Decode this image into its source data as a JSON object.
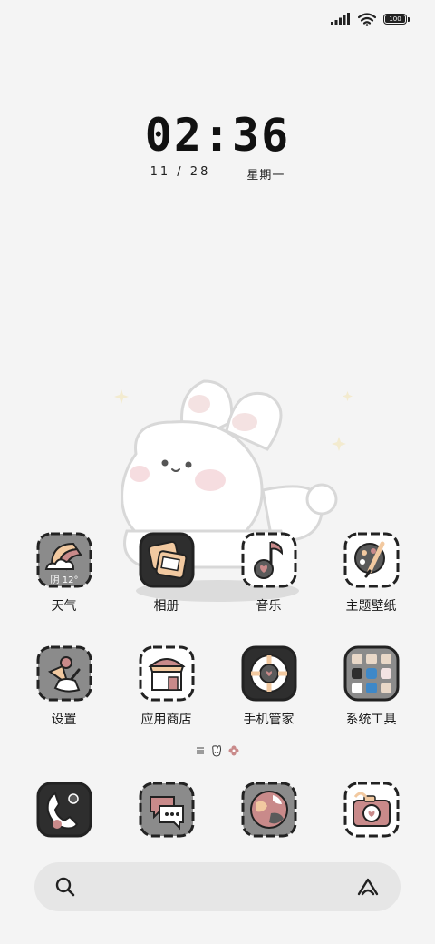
{
  "status_bar": {
    "battery_label": "100"
  },
  "clock": {
    "time": "02:36",
    "date": "11 / 28",
    "weekday": "星期一"
  },
  "weather_widget": {
    "text": "阴 12°"
  },
  "apps_row1": [
    {
      "label": "天气",
      "icon": "weather-icon"
    },
    {
      "label": "相册",
      "icon": "gallery-icon"
    },
    {
      "label": "音乐",
      "icon": "music-icon"
    },
    {
      "label": "主题壁纸",
      "icon": "themes-icon"
    }
  ],
  "apps_row2": [
    {
      "label": "设置",
      "icon": "settings-icon"
    },
    {
      "label": "应用商店",
      "icon": "app-store-icon"
    },
    {
      "label": "手机管家",
      "icon": "security-icon"
    },
    {
      "label": "系统工具",
      "icon": "tools-folder-icon"
    }
  ],
  "dock": [
    {
      "icon": "phone-icon"
    },
    {
      "icon": "messages-icon"
    },
    {
      "icon": "browser-icon"
    },
    {
      "icon": "camera-icon"
    }
  ],
  "colors": {
    "background": "#f4f4f4",
    "icon_dark": "#3a3a3a",
    "icon_gray": "#8a8a8a",
    "accent_pink": "#c98a8a",
    "accent_peach": "#f2c9a0"
  }
}
